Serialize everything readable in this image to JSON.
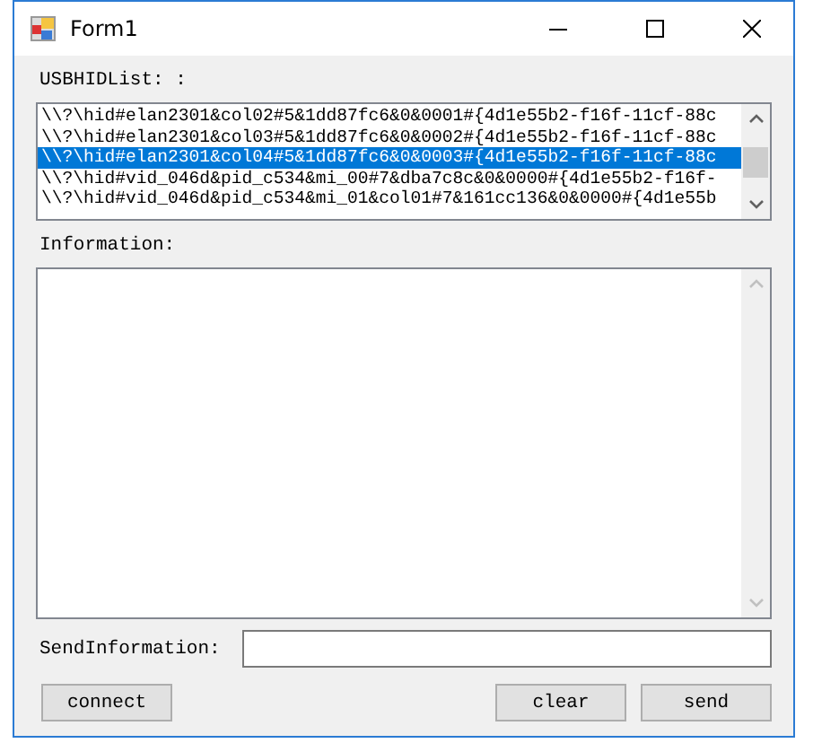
{
  "window": {
    "title": "Form1"
  },
  "usbhid_list": {
    "label": "USBHIDList: :",
    "items": [
      {
        "text": "\\\\?\\hid#elan2301&col02#5&1dd87fc6&0&0001#{4d1e55b2-f16f-11cf-88c",
        "selected": false
      },
      {
        "text": "\\\\?\\hid#elan2301&col03#5&1dd87fc6&0&0002#{4d1e55b2-f16f-11cf-88c",
        "selected": false
      },
      {
        "text": "\\\\?\\hid#elan2301&col04#5&1dd87fc6&0&0003#{4d1e55b2-f16f-11cf-88c",
        "selected": true
      },
      {
        "text": "\\\\?\\hid#vid_046d&pid_c534&mi_00#7&dba7c8c&0&0000#{4d1e55b2-f16f-",
        "selected": false
      },
      {
        "text": "\\\\?\\hid#vid_046d&pid_c534&mi_01&col01#7&161cc136&0&0000#{4d1e55b",
        "selected": false
      }
    ]
  },
  "information": {
    "label": "Information:"
  },
  "send_information": {
    "label": "SendInformation:"
  },
  "buttons": [
    {
      "label": "connect",
      "kind": "left"
    },
    {
      "label": "clear",
      "kind": "right"
    },
    {
      "label": "send",
      "kind": "right"
    }
  ]
}
